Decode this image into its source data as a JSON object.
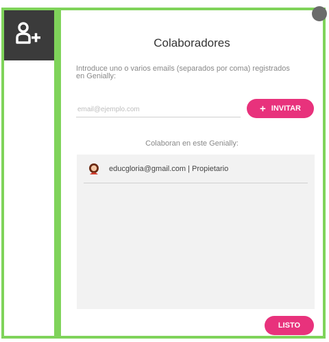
{
  "sidebar": {
    "add_user_icon": "add-user-icon"
  },
  "modal": {
    "title": "Colaboradores",
    "intro_text": "Introduce uno o varios emails (separados por coma) registrados en Genially:",
    "email_placeholder": "email@ejemplo.com",
    "invite_label": "INVITAR",
    "invite_icon": "plus-icon",
    "collaborators_heading": "Colaboran en este Genially:",
    "collaborators": [
      {
        "text": "educgloria@gmail.com | Propietario",
        "avatar_icon": "user-avatar-icon"
      }
    ],
    "done_label": "LISTO"
  },
  "colors": {
    "frame_green": "#7fd35a",
    "sidebar_dark": "#3b3b3b",
    "accent_pink": "#e8327c",
    "list_bg": "#f2f2f2"
  }
}
